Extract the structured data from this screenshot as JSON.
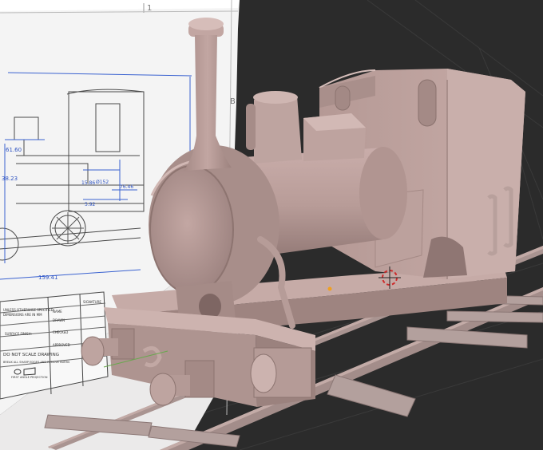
{
  "viewport": {
    "background": "#2b2b2b",
    "grid_color": "#3a3a3a"
  },
  "reference_sheet": {
    "column_number": "1",
    "row_letter": "B",
    "dimensions": {
      "d1": "61.60",
      "d2": "38.23",
      "d3": "15.86",
      "d4": "Ø152",
      "d5": "5.92",
      "d6": "76.46",
      "d7": "159.41"
    },
    "title_block": {
      "notes_line1": "UNLESS OTHERWISE SPECIFIED:",
      "notes_line2": "DIMENSIONS ARE IN MM",
      "name_label": "NAME",
      "signature_label": "SIGNATURE",
      "drawn_label": "DRAWN",
      "checked_label": "CHECKED",
      "approved_label": "APPROVED",
      "surface_finish": "SURFACE FINISH:",
      "do_not_scale": "DO NOT SCALE DRAWING",
      "break_edges": "BREAK ALL SHARP EDGES AND REMOVE BURRS",
      "projection": "FIRST ANGLE PROJECTION"
    }
  },
  "model": {
    "name": "steam-locomotive",
    "body_color": "#b79b96",
    "shadow_color": "#8c7471"
  },
  "gizmos": {
    "cursor_3d": "3d-cursor",
    "origin_point": "object-origin"
  }
}
